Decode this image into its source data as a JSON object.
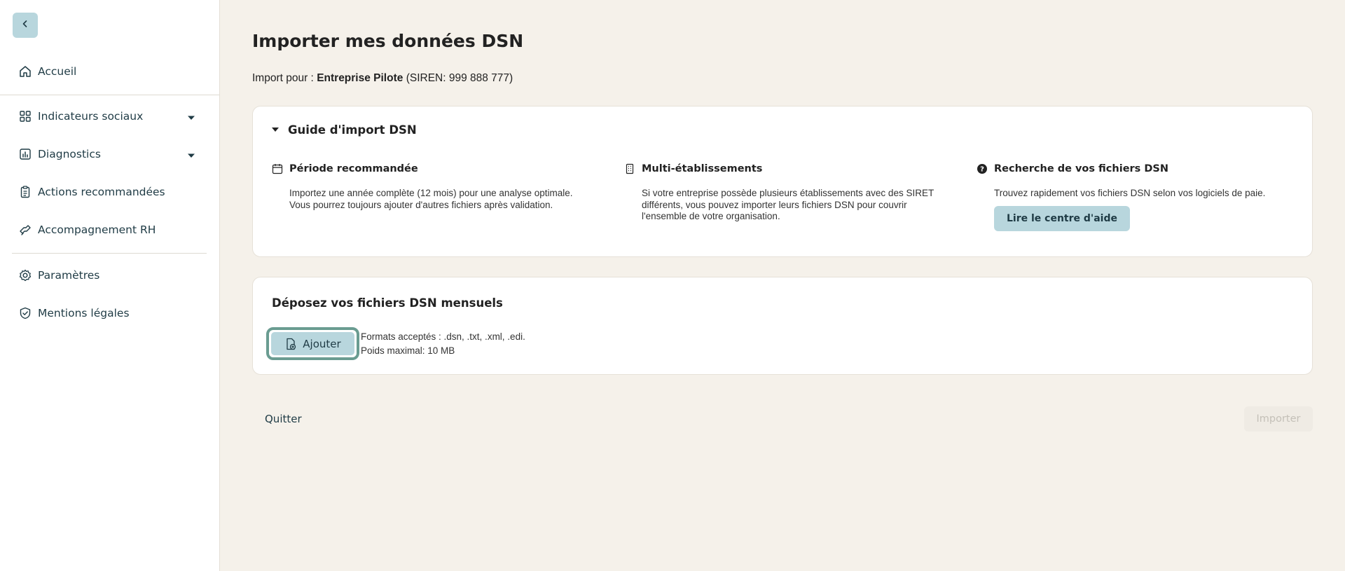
{
  "sidebar": {
    "back_icon": "chevron-left-icon",
    "items": [
      {
        "label": "Accueil",
        "icon": "home-icon"
      },
      {
        "label": "Indicateurs sociaux",
        "icon": "grid-icon",
        "expandable": true
      },
      {
        "label": "Diagnostics",
        "icon": "chart-icon",
        "expandable": true
      },
      {
        "label": "Actions recommandées",
        "icon": "clipboard-icon"
      },
      {
        "label": "Accompagnement RH",
        "icon": "handshake-icon"
      },
      {
        "label": "Paramètres",
        "icon": "gear-icon"
      },
      {
        "label": "Mentions légales",
        "icon": "shield-check-icon"
      }
    ]
  },
  "main": {
    "title": "Importer mes données DSN",
    "import_for_prefix": "Import pour :",
    "company_name": "Entreprise Pilote",
    "siren": "(SIREN: 999 888 777)"
  },
  "guide": {
    "title": "Guide d'import DSN",
    "columns": [
      {
        "icon": "calendar-icon",
        "heading": "Période recommandée",
        "text_lines": [
          "Importez une année complète (12 mois) pour une analyse optimale.",
          "Vous pourrez toujours ajouter d'autres fichiers après validation."
        ]
      },
      {
        "icon": "building-icon",
        "heading": "Multi-établissements",
        "text_lines": [
          "Si votre entreprise possède plusieurs établissements avec des SIRET",
          "différents, vous pouvez importer leurs fichiers DSN pour couvrir",
          "l'ensemble de votre organisation."
        ]
      },
      {
        "icon": "help-circle-icon",
        "heading": "Recherche de vos fichiers DSN",
        "text_lines": [
          "Trouvez rapidement vos fichiers DSN selon vos logiciels de paie."
        ],
        "button_label": "Lire le centre d'aide"
      }
    ]
  },
  "upload": {
    "title": "Déposez vos fichiers DSN mensuels",
    "add_label": "Ajouter",
    "add_icon": "file-plus-icon",
    "formats": "Formats acceptés : .dsn, .txt, .xml, .edi.",
    "max_size": "Poids maximal: 10 MB"
  },
  "footer": {
    "quit_label": "Quitter",
    "import_label": "Importer"
  },
  "colors": {
    "background": "#f5f1ea",
    "accent": "#b8d6dd",
    "focus_ring": "#6a9c91",
    "nav_text": "#1f3b45"
  }
}
